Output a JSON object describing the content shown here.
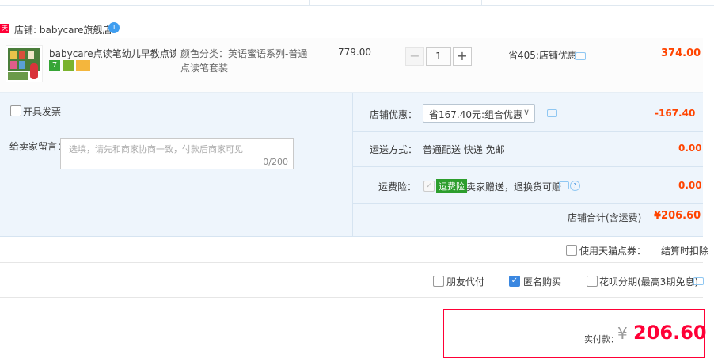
{
  "shop": {
    "tag": "天猫",
    "label": "店铺: babycare旗舰店",
    "badge": "1"
  },
  "item": {
    "title": "babycare点读笔幼儿早教点读…",
    "badges": [
      "7",
      "",
      ""
    ],
    "sku": "颜色分类：英语蜜语系列-普通点读笔套装",
    "unit_price": "779.00",
    "quantity": "1",
    "minus": "−",
    "plus": "+",
    "discount": "省405:店铺优惠",
    "subtotal": "374.00"
  },
  "options": {
    "invoice_label": "开具发票",
    "memo_label": "给卖家留言：",
    "memo_placeholder": "选填，请先和商家协商一致，付款后商家可见",
    "memo_count": "0/200",
    "shop_discount_label": "店铺优惠：",
    "shop_discount_value": "省167.40元:组合优惠",
    "shop_discount_amount": "-167.40",
    "delivery_label": "运送方式：",
    "delivery_value": "普通配送 快递 免邮",
    "delivery_amount": "0.00",
    "insurance_label": "运费险：",
    "insurance_tag": "运费险",
    "insurance_desc": "卖家赠送，退换货可赔",
    "insurance_amount": "0.00",
    "total_label": "店铺合计(含运费)",
    "total_amount": "¥206.60"
  },
  "points": {
    "label": "使用天猫点券：",
    "note": "结算时扣除"
  },
  "extras": {
    "friend_pay": "朋友代付",
    "anonymous": "匿名购买",
    "huabei": "花呗分期(最高3期免息)"
  },
  "payment": {
    "label": "实付款：",
    "currency": "¥",
    "amount": "206.60"
  },
  "colors": {
    "accent": "#ff0036",
    "price": "#ff4400",
    "panel": "#eef5fc"
  }
}
